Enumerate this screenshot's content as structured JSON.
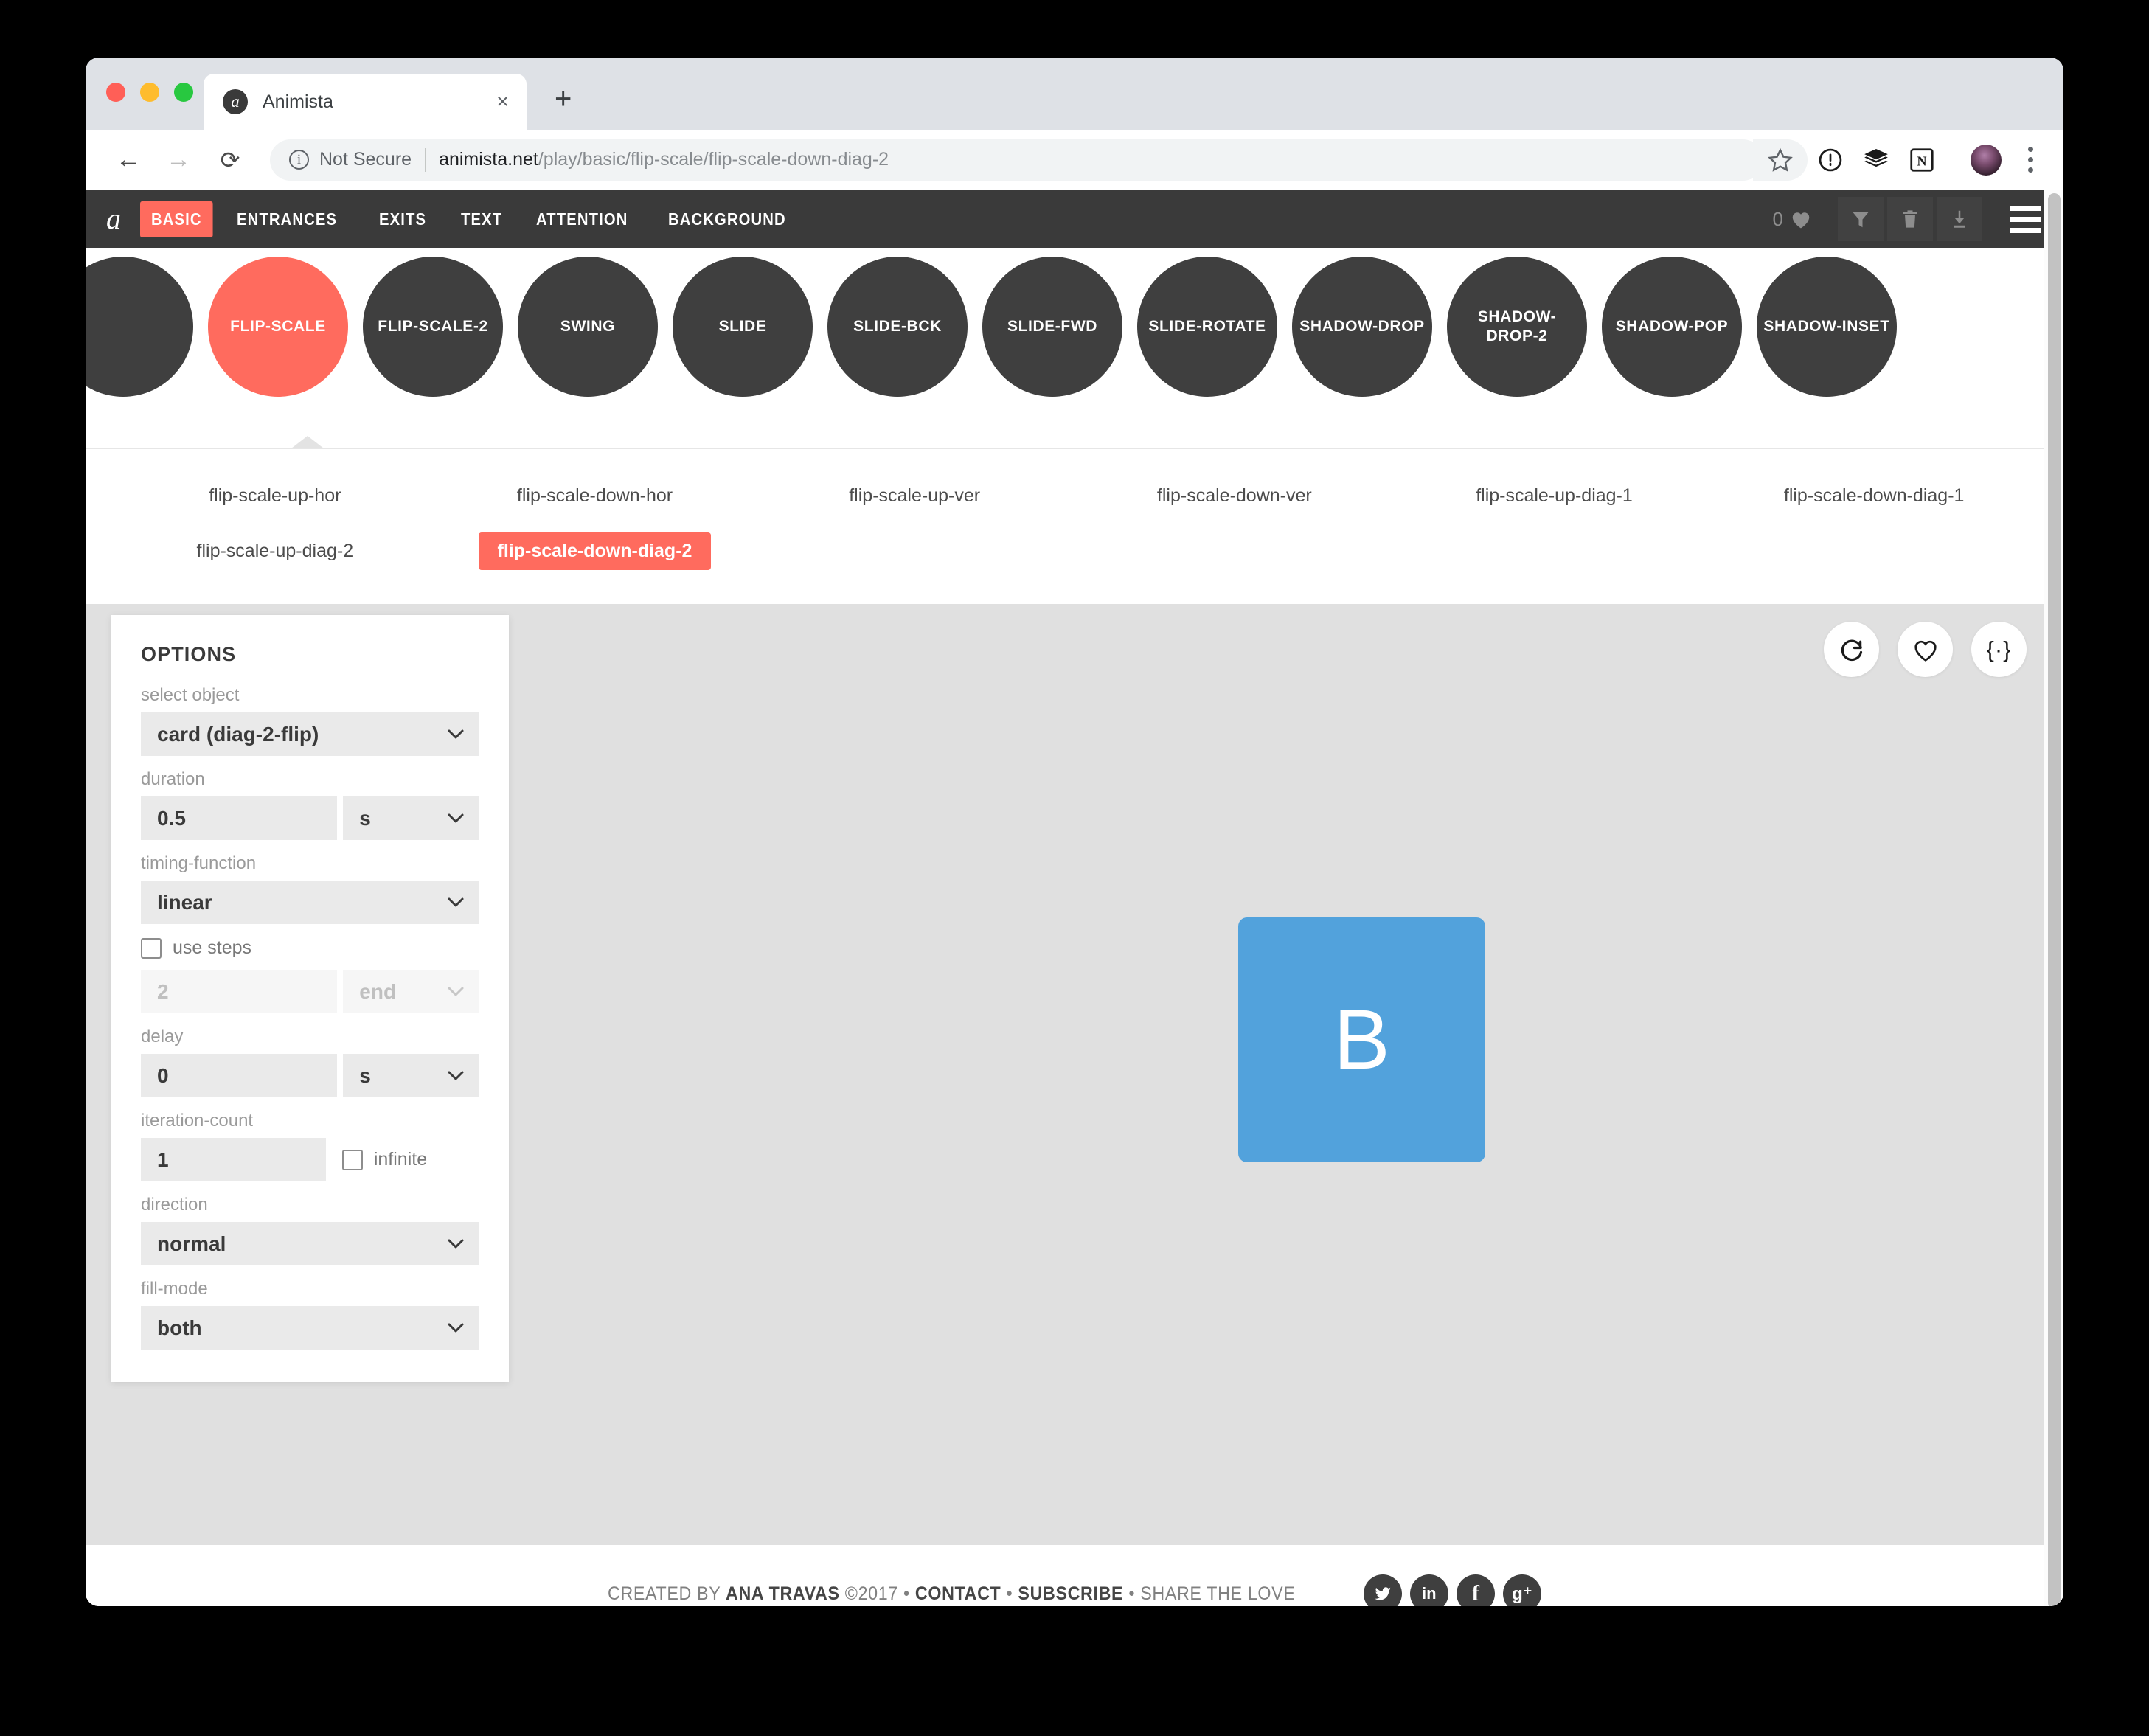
{
  "browser": {
    "tab": {
      "title": "Animista",
      "favicon": "a",
      "close_label": "×"
    },
    "new_tab_label": "+",
    "nav": {
      "back": "←",
      "forward": "→",
      "reload": "⟳"
    },
    "omnibox": {
      "security_label": "Not Secure",
      "info_icon": "i",
      "url_host": "animista.net",
      "url_path": "/play/basic/flip-scale/flip-scale-down-diag-2"
    },
    "toolbar_icons": [
      {
        "name": "bookmark-star-icon",
        "glyph": "☆"
      },
      {
        "name": "onepassword-extension-icon",
        "glyph": "ⓘ"
      },
      {
        "name": "buffer-extension-icon",
        "glyph": "⬟"
      },
      {
        "name": "notion-extension-icon",
        "glyph": "N"
      }
    ]
  },
  "site_nav": {
    "logo": "a",
    "items": [
      {
        "label": "BASIC",
        "active": true
      },
      {
        "label": "ENTRANCES",
        "active": false
      },
      {
        "label": "EXITS",
        "active": false
      },
      {
        "label": "TEXT",
        "active": false
      },
      {
        "label": "ATTENTION",
        "active": false
      },
      {
        "label": "BACKGROUND",
        "active": false
      }
    ],
    "favorites_count": "0",
    "heart_icon": "♥",
    "tools": [
      {
        "name": "filter-icon",
        "glyph": "▼"
      },
      {
        "name": "trash-icon",
        "glyph": "🗑"
      },
      {
        "name": "download-icon",
        "glyph": "⬇"
      }
    ]
  },
  "categories": [
    {
      "label": "",
      "selected": false,
      "partial": true
    },
    {
      "label": "FLIP-SCALE",
      "selected": true
    },
    {
      "label": "FLIP-SCALE-2",
      "selected": false
    },
    {
      "label": "SWING",
      "selected": false
    },
    {
      "label": "SLIDE",
      "selected": false
    },
    {
      "label": "SLIDE-BCK",
      "selected": false
    },
    {
      "label": "SLIDE-FWD",
      "selected": false
    },
    {
      "label": "SLIDE-ROTATE",
      "selected": false
    },
    {
      "label": "SHADOW-DROP",
      "selected": false
    },
    {
      "label": "SHADOW-DROP-2",
      "selected": false
    },
    {
      "label": "SHADOW-POP",
      "selected": false
    },
    {
      "label": "SHADOW-INSET",
      "selected": false
    }
  ],
  "variants": [
    {
      "label": "flip-scale-up-hor",
      "selected": false
    },
    {
      "label": "flip-scale-down-hor",
      "selected": false
    },
    {
      "label": "flip-scale-up-ver",
      "selected": false
    },
    {
      "label": "flip-scale-down-ver",
      "selected": false
    },
    {
      "label": "flip-scale-up-diag-1",
      "selected": false
    },
    {
      "label": "flip-scale-down-diag-1",
      "selected": false
    },
    {
      "label": "flip-scale-up-diag-2",
      "selected": false
    },
    {
      "label": "flip-scale-down-diag-2",
      "selected": true
    }
  ],
  "options": {
    "title": "OPTIONS",
    "select_object": {
      "label": "select object",
      "value": "card (diag-2-flip)"
    },
    "duration": {
      "label": "duration",
      "value": "0.5",
      "unit": "s"
    },
    "timing_function": {
      "label": "timing-function",
      "value": "linear"
    },
    "use_steps": {
      "label": "use steps",
      "checked": false,
      "steps_value": "2",
      "steps_position": "end"
    },
    "delay": {
      "label": "delay",
      "value": "0",
      "unit": "s"
    },
    "iteration_count": {
      "label": "iteration-count",
      "value": "1",
      "infinite_label": "infinite",
      "infinite_checked": false
    },
    "direction": {
      "label": "direction",
      "value": "normal"
    },
    "fill_mode": {
      "label": "fill-mode",
      "value": "both"
    },
    "chevron": "⌄"
  },
  "preview": {
    "card_letter": "B",
    "card_color": "#52a2dc",
    "actions": [
      {
        "name": "replay-icon",
        "glyph": "⟳"
      },
      {
        "name": "favorite-heart-icon",
        "glyph": "♡"
      },
      {
        "name": "code-braces-icon",
        "glyph": "{·}"
      }
    ]
  },
  "footer": {
    "prefix": "CREATED BY ",
    "author": "ANA TRAVAS",
    "copyright": " ©2017 • ",
    "contact": "CONTACT",
    "sep1": " • ",
    "subscribe": "SUBSCRIBE",
    "sep2": " • ",
    "share": "SHARE THE LOVE",
    "socials": [
      {
        "name": "twitter-icon",
        "glyph": "ᵛ"
      },
      {
        "name": "linkedin-icon",
        "glyph": "in"
      },
      {
        "name": "facebook-icon",
        "glyph": "f"
      },
      {
        "name": "googleplus-icon",
        "glyph": "g⁺"
      }
    ]
  },
  "theme": {
    "accent": "#ff6b5e",
    "dark": "#3a3a3a",
    "playground_bg": "#e0e0e0"
  }
}
